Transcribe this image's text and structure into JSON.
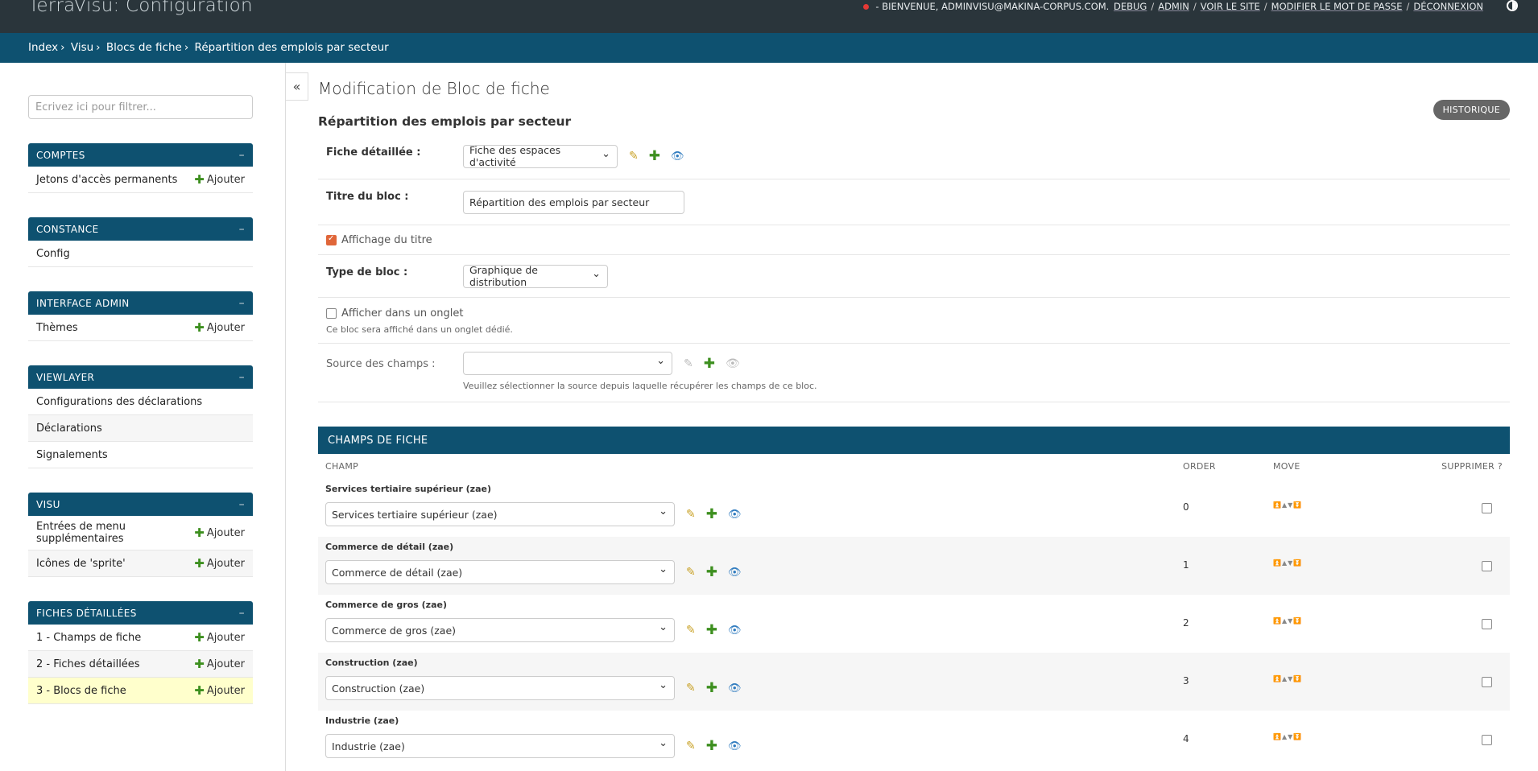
{
  "header": {
    "brand": "TerraVisu: Configuration",
    "welcome": "BIENVENUE, ADMINVISU@MAKINA-CORPUS.COM.",
    "links": [
      "DEBUG",
      "ADMIN",
      "VOIR LE SITE",
      "MODIFIER LE MOT DE PASSE",
      "DÉCONNEXION"
    ]
  },
  "breadcrumbs": [
    "Index",
    "Visu",
    "Blocs de fiche",
    "Répartition des emplois par secteur"
  ],
  "sidebar": {
    "filter_placeholder": "Écrivez ici pour filtrer...",
    "add_label": "Ajouter",
    "modules": [
      {
        "title": "COMPTES",
        "items": [
          {
            "label": "Jetons d'accès permanents",
            "add": true
          }
        ]
      },
      {
        "title": "CONSTANCE",
        "items": [
          {
            "label": "Config",
            "add": false
          }
        ]
      },
      {
        "title": "INTERFACE ADMIN",
        "items": [
          {
            "label": "Thèmes",
            "add": true
          }
        ]
      },
      {
        "title": "VIEWLAYER",
        "items": [
          {
            "label": "Configurations des déclarations",
            "add": false
          },
          {
            "label": "Déclarations",
            "add": false
          },
          {
            "label": "Signalements",
            "add": false
          }
        ]
      },
      {
        "title": "VISU",
        "items": [
          {
            "label": "Entrées de menu supplémentaires",
            "add": true
          },
          {
            "label": "Icônes de 'sprite'",
            "add": true
          }
        ]
      },
      {
        "title": "FICHES DÉTAILLÉES",
        "items": [
          {
            "label": "1 - Champs de fiche",
            "add": true
          },
          {
            "label": "2 - Fiches détaillées",
            "add": true
          },
          {
            "label": "3 - Blocs de fiche",
            "add": true
          }
        ]
      }
    ],
    "collapse_label": "«"
  },
  "content": {
    "page_title": "Modification de Bloc de fiche",
    "object_title": "Répartition des emplois par secteur",
    "history_button": "HISTORIQUE",
    "fields": {
      "fiche_label": "Fiche détaillée :",
      "fiche_value": "Fiche des espaces d'activité",
      "titre_label": "Titre du bloc :",
      "titre_value": "Répartition des emplois par secteur",
      "affichage_label": "Affichage du titre",
      "type_label": "Type de bloc :",
      "type_value": "Graphique de distribution",
      "onglet_label": "Afficher dans un onglet",
      "onglet_help": "Ce bloc sera affiché dans un onglet dédié.",
      "source_label": "Source des champs :",
      "source_value": "",
      "source_help": "Veuillez sélectionner la source depuis laquelle récupérer les champs de ce bloc."
    },
    "inline": {
      "title": "CHAMPS DE FICHE",
      "columns": {
        "champ": "CHAMP",
        "order": "ORDER",
        "move": "MOVE",
        "delete": "SUPPRIMER ?"
      },
      "move_glyphs": "⏫▲▼⏬",
      "rows": [
        {
          "label": "Services tertiaire supérieur (zae)",
          "value": "Services tertiaire supérieur (zae)",
          "order": "0"
        },
        {
          "label": "Commerce de détail (zae)",
          "value": "Commerce de détail (zae)",
          "order": "1"
        },
        {
          "label": "Commerce de gros (zae)",
          "value": "Commerce de gros (zae)",
          "order": "2"
        },
        {
          "label": "Construction (zae)",
          "value": "Construction (zae)",
          "order": "3"
        },
        {
          "label": "Industrie (zae)",
          "value": "Industrie (zae)",
          "order": "4"
        }
      ]
    }
  },
  "colors": {
    "header_bg": "#2a353b",
    "primary": "#0e5170",
    "brand": "#f5dd5d",
    "add_green": "#3d8f1f",
    "highlight": "#ffffcc"
  }
}
